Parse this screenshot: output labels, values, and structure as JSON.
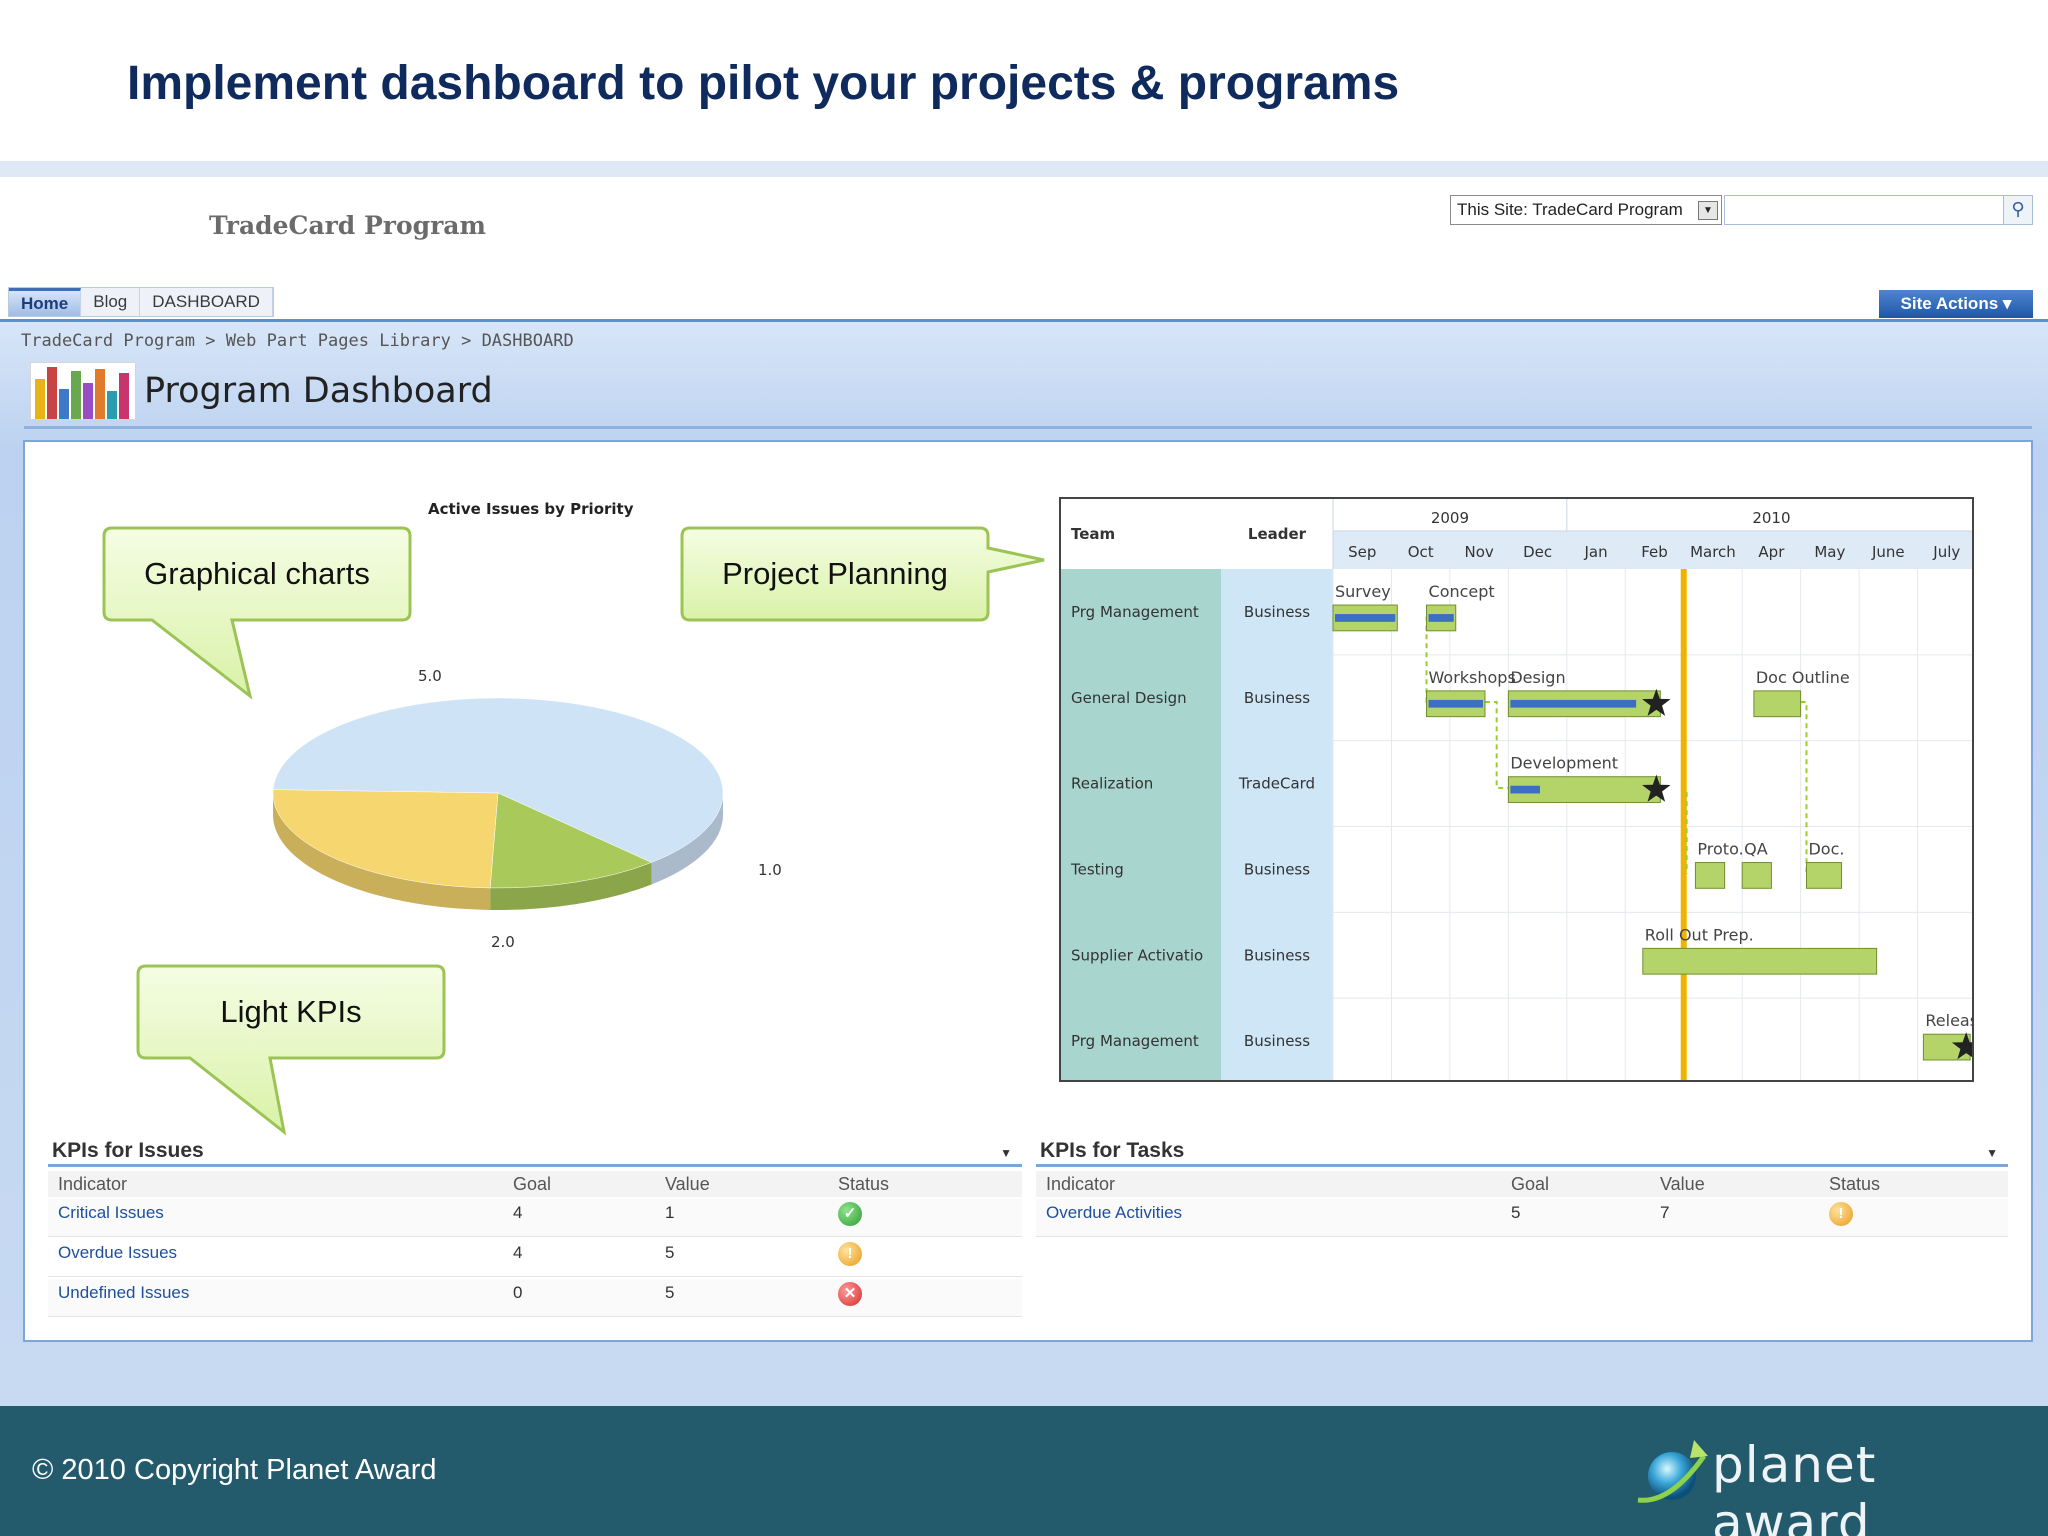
{
  "slide_title": "Implement dashboard to pilot your projects & programs",
  "footer": {
    "copyright": "© 2010 Copyright Planet Award",
    "logo_text": "planet award"
  },
  "site": {
    "brand": "TradeCard Program",
    "search_scope": "This Site: TradeCard Program",
    "search_placeholder": "",
    "tabs": [
      "Home",
      "Blog",
      "DASHBOARD"
    ],
    "active_tab": "Home",
    "site_actions_label": "Site Actions",
    "breadcrumb": "TradeCard Program > Web Part Pages Library > DASHBOARD",
    "page_title": "Program Dashboard"
  },
  "callouts": {
    "charts": "Graphical charts",
    "planning": "Project Planning",
    "kpis": "Light KPIs"
  },
  "chart_data": {
    "type": "pie",
    "title": "Active Issues by Priority",
    "slices": [
      {
        "label": "5.0",
        "value": 5.0,
        "color": "#cfe3f7"
      },
      {
        "label": "1.0",
        "value": 1.0,
        "color": "#a9c95a"
      },
      {
        "label": "2.0",
        "value": 2.0,
        "color": "#f6d66e"
      }
    ]
  },
  "gantt": {
    "headers": {
      "team": "Team",
      "leader": "Leader"
    },
    "years": [
      "2009",
      "2010"
    ],
    "months": [
      "Sep",
      "Oct",
      "Nov",
      "Dec",
      "Jan",
      "Feb",
      "March",
      "Apr",
      "May",
      "June",
      "July"
    ],
    "rows": [
      {
        "team": "Prg Management",
        "leader": "Business"
      },
      {
        "team": "General Design",
        "leader": "Business"
      },
      {
        "team": "Realization",
        "leader": "TradeCard"
      },
      {
        "team": "Testing",
        "leader": "Business"
      },
      {
        "team": "Supplier Activatio",
        "leader": "Business"
      },
      {
        "team": "Prg Management",
        "leader": "Business"
      }
    ],
    "tasks": [
      {
        "label": "Survey",
        "row": 0,
        "start": 0.0,
        "end": 1.1,
        "progress": 1.0,
        "milestone": false
      },
      {
        "label": "Concept",
        "row": 0,
        "start": 1.6,
        "end": 2.1,
        "progress": 1.0,
        "milestone": false
      },
      {
        "label": "Workshops",
        "row": 1,
        "start": 1.6,
        "end": 2.6,
        "progress": 1.0,
        "milestone": false
      },
      {
        "label": "Design",
        "row": 1,
        "start": 3.0,
        "end": 5.6,
        "progress": 0.85,
        "milestone": true
      },
      {
        "label": "Doc Outline",
        "row": 1,
        "start": 7.2,
        "end": 8.0,
        "progress": 0,
        "milestone": false
      },
      {
        "label": "Development",
        "row": 2,
        "start": 3.0,
        "end": 5.6,
        "progress": 0.2,
        "milestone": true
      },
      {
        "label": "Proto.",
        "row": 3,
        "start": 6.2,
        "end": 6.7,
        "progress": 0,
        "milestone": false
      },
      {
        "label": "QA",
        "row": 3,
        "start": 7.0,
        "end": 7.5,
        "progress": 0,
        "milestone": false
      },
      {
        "label": "Doc.",
        "row": 3,
        "start": 8.1,
        "end": 8.7,
        "progress": 0,
        "milestone": false
      },
      {
        "label": "Roll Out Prep.",
        "row": 4,
        "start": 5.3,
        "end": 9.3,
        "progress": 0,
        "milestone": false
      },
      {
        "label": "Release",
        "row": 5,
        "start": 10.1,
        "end": 10.9,
        "progress": 0,
        "milestone": true
      }
    ],
    "today": 6.0
  },
  "kpi_issues": {
    "title": "KPIs for Issues",
    "columns": [
      "Indicator",
      "Goal",
      "Value",
      "Status"
    ],
    "rows": [
      {
        "indicator": "Critical Issues",
        "goal": "4",
        "value": "1",
        "status": "ok",
        "status_icon": "check-icon"
      },
      {
        "indicator": "Overdue Issues",
        "goal": "4",
        "value": "5",
        "status": "warn",
        "status_icon": "warning-icon"
      },
      {
        "indicator": "Undefined Issues",
        "goal": "0",
        "value": "5",
        "status": "bad",
        "status_icon": "error-icon"
      }
    ]
  },
  "kpi_tasks": {
    "title": "KPIs for Tasks",
    "columns": [
      "Indicator",
      "Goal",
      "Value",
      "Status"
    ],
    "rows": [
      {
        "indicator": "Overdue Activities",
        "goal": "5",
        "value": "7",
        "status": "warn",
        "status_icon": "warning-icon"
      }
    ]
  }
}
